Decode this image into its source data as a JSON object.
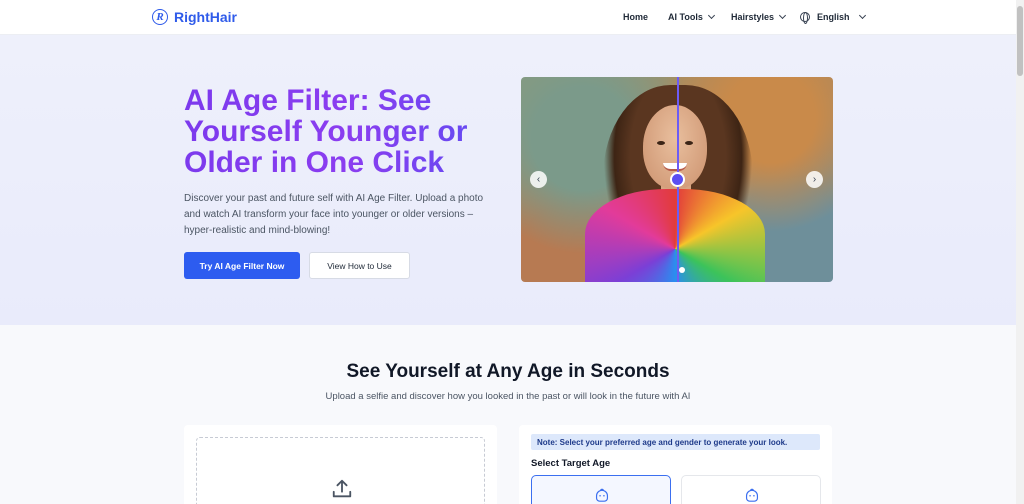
{
  "brand": {
    "name": "RightHair",
    "logo_letter": "R"
  },
  "nav": {
    "home": "Home",
    "ai_tools": "AI Tools",
    "hairstyles": "Hairstyles",
    "language": "English"
  },
  "hero": {
    "title": "AI Age Filter: See Yourself Younger or Older in One Click",
    "description": "Discover your past and future self with AI Age Filter. Upload a photo and watch AI transform your face into younger or older versions – hyper-realistic and mind-blowing!",
    "primary_button": "Try AI Age Filter Now",
    "secondary_button": "View How to Use",
    "carousel_prev": "‹",
    "carousel_next": "›"
  },
  "section": {
    "title": "See Yourself at Any Age in Seconds",
    "subtitle": "Upload a selfie and discover how you looked in the past or will look in the future with AI"
  },
  "tool": {
    "note": "Note: Select your preferred age and gender to generate your look.",
    "target_age_label": "Select Target Age"
  },
  "colors": {
    "brand": "#2f5bea",
    "title_gradient_start": "#7c3aed",
    "title_gradient_end": "#5b4ef2",
    "primary_button": "#2d5cf0"
  },
  "icons": {
    "upload": "upload-icon",
    "language": "globe-icon",
    "age_option": "baby-face-icon"
  }
}
